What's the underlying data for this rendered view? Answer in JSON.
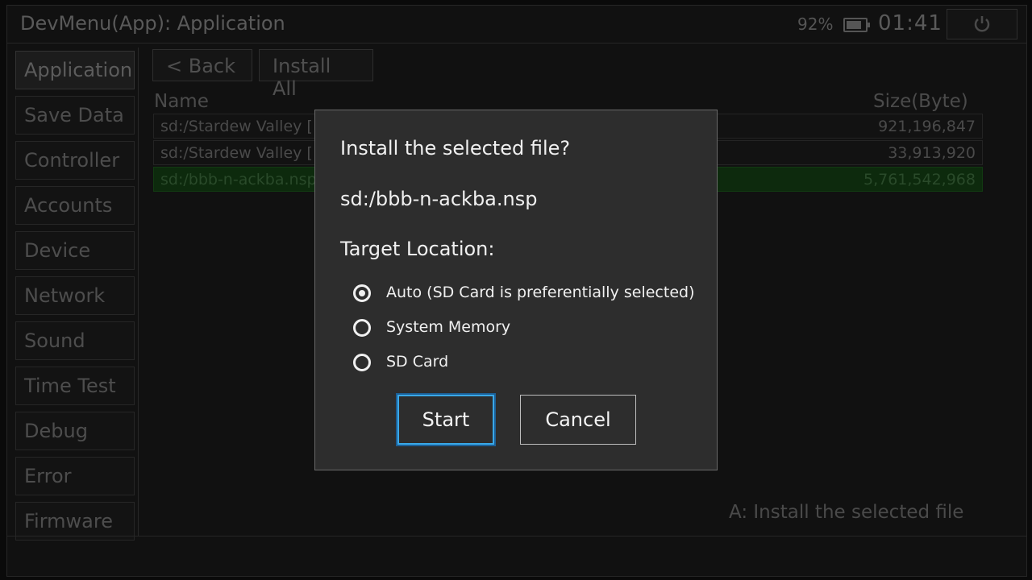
{
  "window": {
    "title": "DevMenu(App): Application",
    "battery_percent": "92%",
    "clock": "01:41"
  },
  "sidebar": {
    "items": [
      {
        "label": "Application",
        "active": true
      },
      {
        "label": "Save Data"
      },
      {
        "label": "Controller"
      },
      {
        "label": "Accounts"
      },
      {
        "label": "Device"
      },
      {
        "label": "Network"
      },
      {
        "label": "Sound"
      },
      {
        "label": "Time Test"
      },
      {
        "label": "Debug"
      },
      {
        "label": "Error"
      },
      {
        "label": "Firmware"
      }
    ]
  },
  "toolbar": {
    "back_label": "< Back",
    "install_all_label": "Install All"
  },
  "file_table": {
    "columns": [
      "Name",
      "Size(Byte)"
    ],
    "rows": [
      {
        "name": "sd:/Stardew Valley [",
        "size": "921,196,847"
      },
      {
        "name": "sd:/Stardew Valley [",
        "size": "33,913,920"
      },
      {
        "name": "sd:/bbb-n-ackba.nsp",
        "size": "5,761,542,968",
        "selected": true
      }
    ]
  },
  "hint": "A: Install the selected file",
  "dialog": {
    "title": "Install the selected file?",
    "file": "sd:/bbb-n-ackba.nsp",
    "target_label": "Target Location:",
    "options": [
      {
        "label": "Auto (SD Card is preferentially selected)",
        "checked": true
      },
      {
        "label": "System Memory",
        "checked": false
      },
      {
        "label": "SD Card",
        "checked": false
      }
    ],
    "start_label": "Start",
    "cancel_label": "Cancel"
  },
  "colors": {
    "focus_border": "#3aa8e8",
    "selected_row": "#0d2a0d",
    "dialog_bg": "#2d2d2d"
  }
}
